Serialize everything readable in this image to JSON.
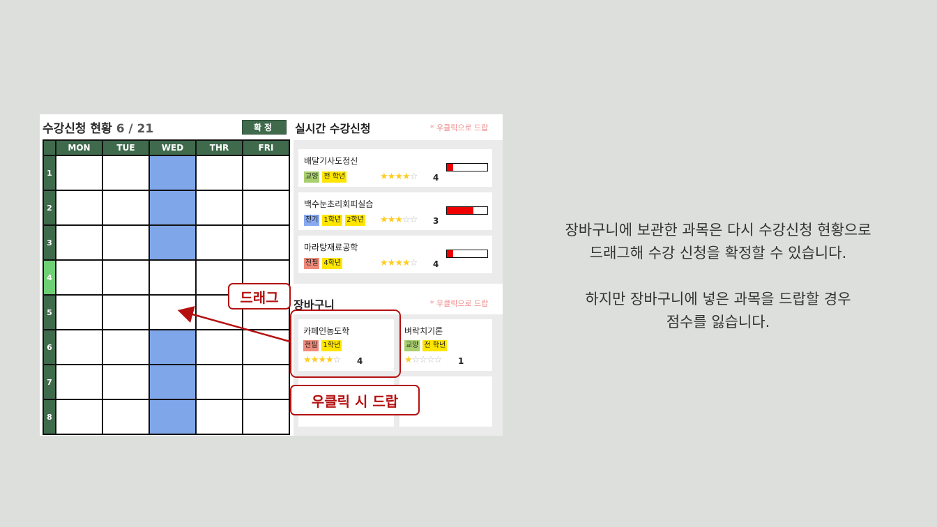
{
  "timetable": {
    "title": "수강신청 현황",
    "count": "6 / 21",
    "confirm_label": "확정",
    "days": [
      "MON",
      "TUE",
      "WED",
      "THR",
      "FRI"
    ],
    "periods": [
      "1",
      "2",
      "3",
      "4",
      "5",
      "6",
      "7",
      "8"
    ],
    "highlighted_period": "4",
    "filled_cells": [
      [
        1,
        "WED"
      ],
      [
        2,
        "WED"
      ],
      [
        3,
        "WED"
      ],
      [
        6,
        "WED"
      ],
      [
        7,
        "WED"
      ],
      [
        8,
        "WED"
      ]
    ]
  },
  "realtime": {
    "title": "실시간 수강신청",
    "hint": "* 우클릭으로 드랍",
    "courses": [
      {
        "name": "배달기사도정신",
        "tags": [
          {
            "text": "교양",
            "color": "green"
          },
          {
            "text": "전 학년",
            "color": "yellow"
          }
        ],
        "stars": 4,
        "score": "4",
        "fill": 0.15
      },
      {
        "name": "백수눈초리회피실습",
        "tags": [
          {
            "text": "전기",
            "color": "blue"
          },
          {
            "text": "1학년",
            "color": "yellow"
          },
          {
            "text": "2학년",
            "color": "yellow"
          }
        ],
        "stars": 3,
        "score": "3",
        "fill": 0.65
      },
      {
        "name": "마라탕재료공학",
        "tags": [
          {
            "text": "전필",
            "color": "red"
          },
          {
            "text": "4학년",
            "color": "yellow"
          }
        ],
        "stars": 4,
        "score": "4",
        "fill": 0.15
      }
    ]
  },
  "basket": {
    "title": "장바구니",
    "hint": "* 우클릭으로 드랍",
    "items": [
      {
        "name": "카페인농도학",
        "tags": [
          {
            "text": "전필",
            "color": "red"
          },
          {
            "text": "1학년",
            "color": "yellow"
          }
        ],
        "stars": 4,
        "score": "4"
      },
      {
        "name": "벼락치기론",
        "tags": [
          {
            "text": "교양",
            "color": "green"
          },
          {
            "text": "전 학년",
            "color": "yellow"
          }
        ],
        "stars": 1,
        "score": "1"
      }
    ]
  },
  "annotations": {
    "drag": "드래그",
    "right_click_drop": "우클릭 시 드랍"
  },
  "description": {
    "line1": "장바구니에 보관한 과목은 다시 수강신청 현황으로",
    "line2": "드래그해 수강 신청을 확정할 수 있습니다.",
    "line3": "하지만 장바구니에 넣은 과목을 드랍할 경우",
    "line4": "점수를 잃습니다."
  },
  "colors": {
    "background": "#dddfdd",
    "timetable_header": "#3f6a4c",
    "filled_cell": "#7fa6e9",
    "highlight_period": "#6fcf75",
    "annotation_red": "#b51010",
    "capacity_bar": "#ee0000",
    "star": "#ffcc22"
  }
}
